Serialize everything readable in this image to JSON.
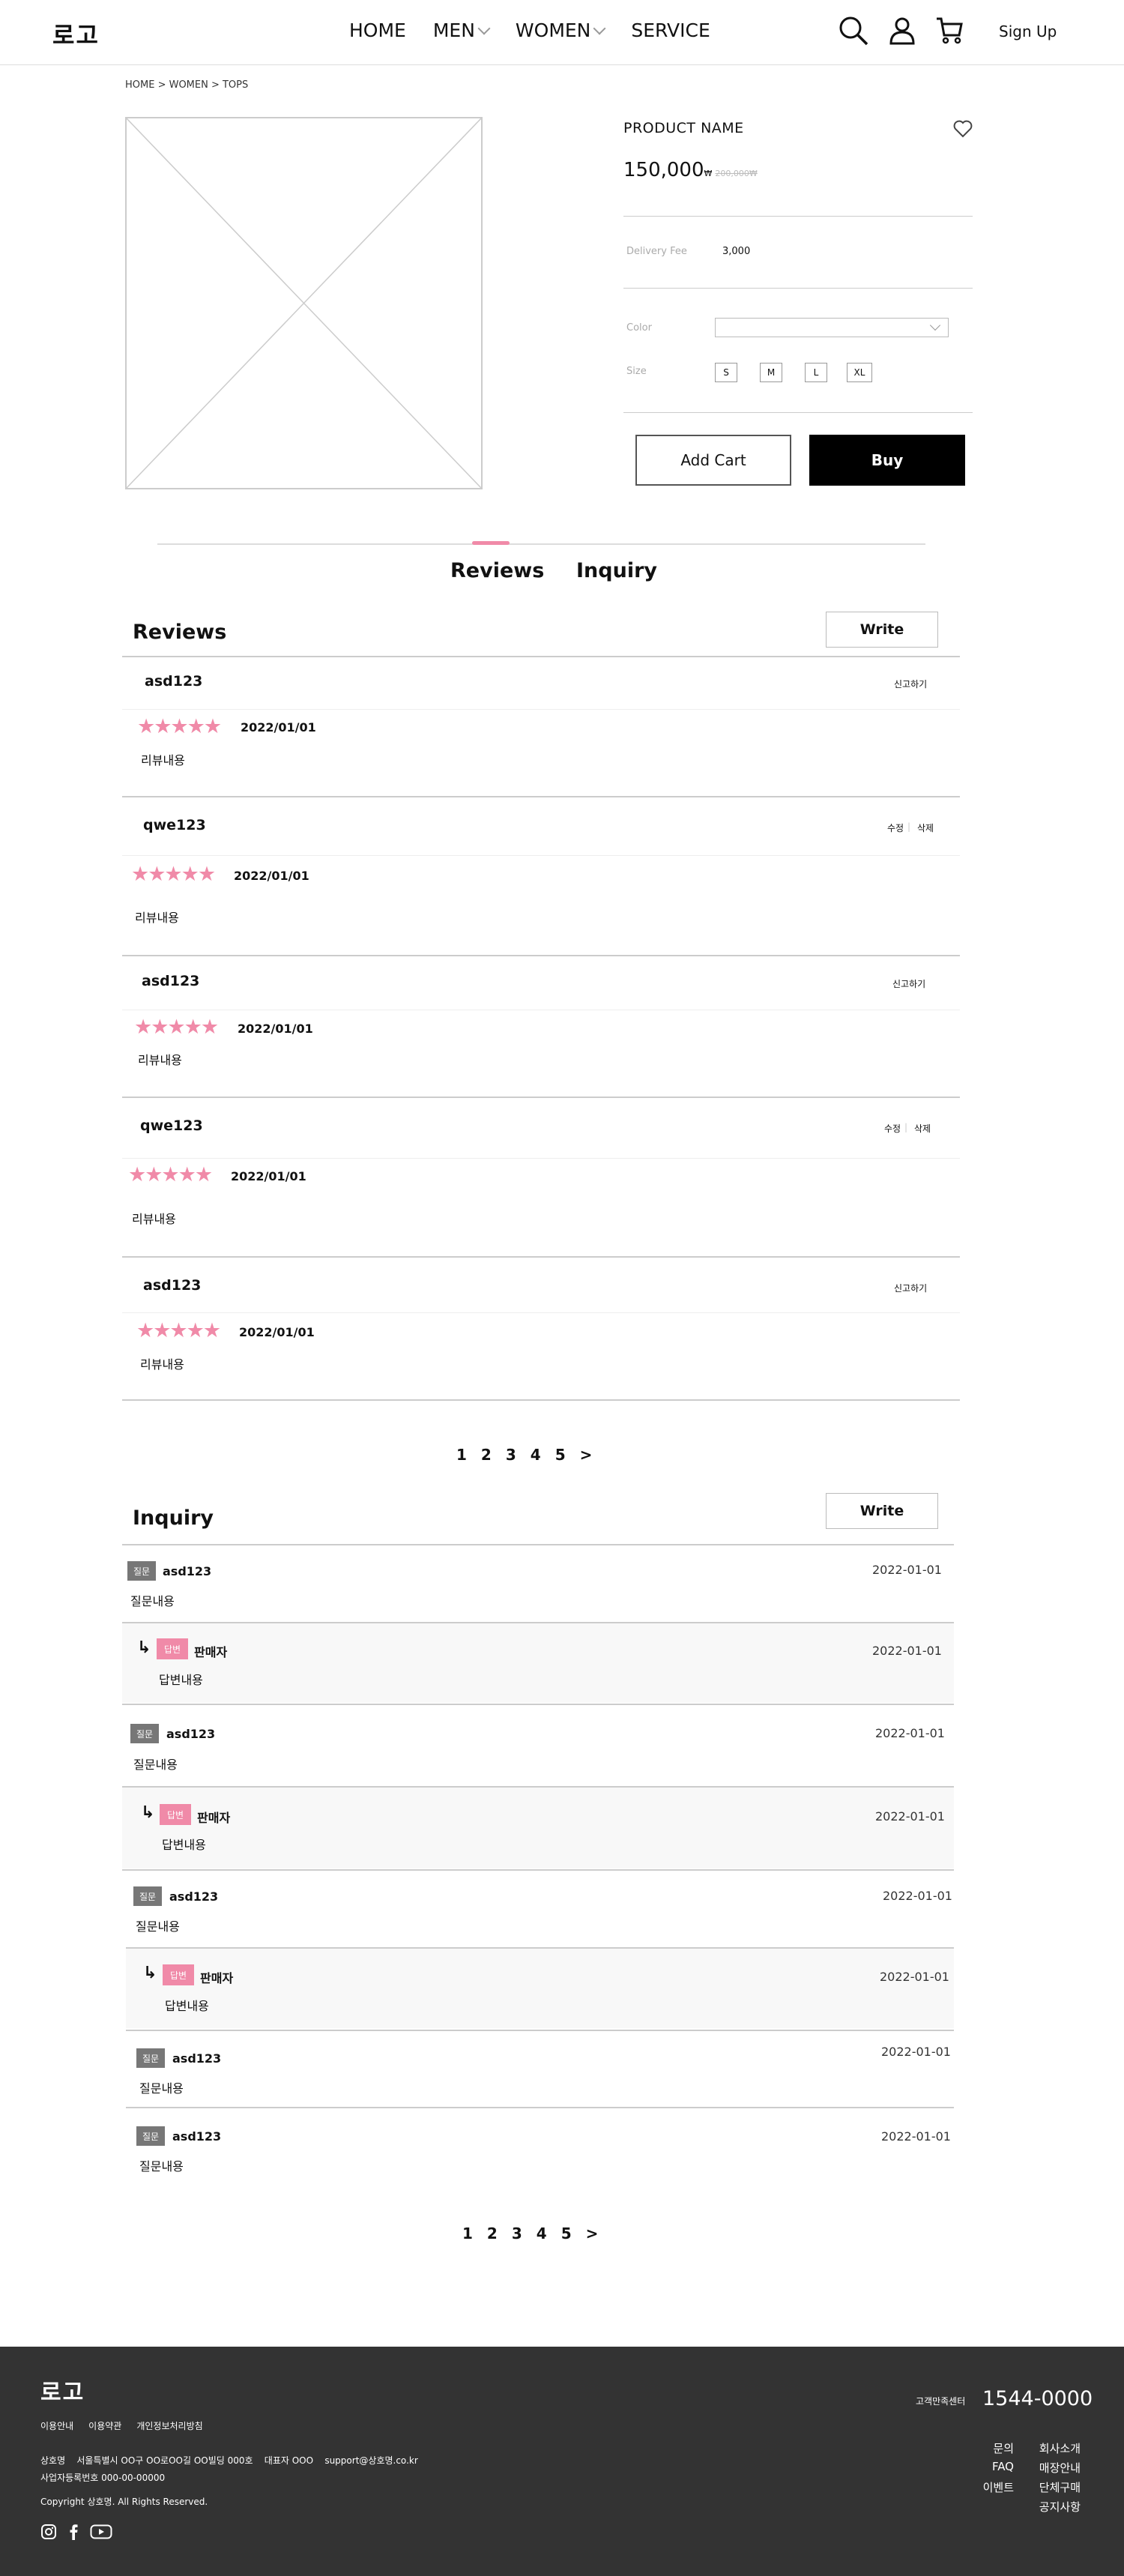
{
  "header": {
    "logo": "로고",
    "nav": [
      "HOME",
      "MEN",
      "WOMEN",
      "SERVICE"
    ],
    "signup": "Sign Up"
  },
  "breadcrumb": "HOME > WOMEN > TOPS",
  "product": {
    "name": "PRODUCT NAME",
    "price": "150,000",
    "price_unit": "₩",
    "original_price": "200,000₩",
    "delivery_label": "Delivery Fee",
    "delivery_value": "3,000",
    "color_label": "Color",
    "size_label": "Size",
    "sizes": [
      "S",
      "M",
      "L",
      "XL"
    ],
    "add_cart": "Add Cart",
    "buy": "Buy"
  },
  "tabs": [
    "Reviews",
    "Inquiry"
  ],
  "reviews": {
    "title": "Reviews",
    "write": "Write",
    "stars": "★★★★★",
    "items": [
      {
        "user": "asd123",
        "date": "2022/01/01",
        "content": "리뷰내용",
        "action": "신고하기"
      },
      {
        "user": "qwe123",
        "date": "2022/01/01",
        "content": "리뷰내용",
        "edit": "수정",
        "delete": "삭제"
      },
      {
        "user": "asd123",
        "date": "2022/01/01",
        "content": "리뷰내용",
        "action": "신고하기"
      },
      {
        "user": "qwe123",
        "date": "2022/01/01",
        "content": "리뷰내용",
        "edit": "수정",
        "delete": "삭제"
      },
      {
        "user": "asd123",
        "date": "2022/01/01",
        "content": "리뷰내용",
        "action": "신고하기"
      }
    ]
  },
  "pagination": [
    "1",
    "2",
    "3",
    "4",
    "5",
    ">"
  ],
  "inquiry": {
    "title": "Inquiry",
    "write": "Write",
    "q_badge": "질문",
    "a_badge": "답변",
    "items": [
      {
        "user": "asd123",
        "date": "2022-01-01",
        "question": "질문내용",
        "answer_user": "판매자",
        "answer_date": "2022-01-01",
        "answer": "답변내용"
      },
      {
        "user": "asd123",
        "date": "2022-01-01",
        "question": "질문내용",
        "answer_user": "판매자",
        "answer_date": "2022-01-01",
        "answer": "답변내용"
      },
      {
        "user": "asd123",
        "date": "2022-01-01",
        "question": "질문내용",
        "answer_user": "판매자",
        "answer_date": "2022-01-01",
        "answer": "답변내용"
      },
      {
        "user": "asd123",
        "date": "2022-01-01",
        "question": "질문내용"
      },
      {
        "user": "asd123",
        "date": "2022-01-01",
        "question": "질문내용"
      }
    ]
  },
  "footer": {
    "logo": "로고",
    "links": [
      "이용안내",
      "이용약관",
      "개인정보처리방침"
    ],
    "company_line": "상호명    서울특별시 OO구 OO로OO길 OO빌딩 000호    대표자 OOO    support@상호명.co.kr",
    "business_no": "사업자등록번호 000-00-00000",
    "copyright": "Copyright 상호명. All Rights Reserved.",
    "cs_label": "고객만족센터",
    "cs_phone": "1544-0000",
    "menu_col1": [
      "문의",
      "FAQ",
      "이벤트"
    ],
    "menu_col2": [
      "회사소개",
      "매장안내",
      "단체구매",
      "공지사항"
    ]
  },
  "colors": {
    "accent": "#f08aa8",
    "footer_bg": "#333333",
    "badge_gray": "#777777"
  }
}
